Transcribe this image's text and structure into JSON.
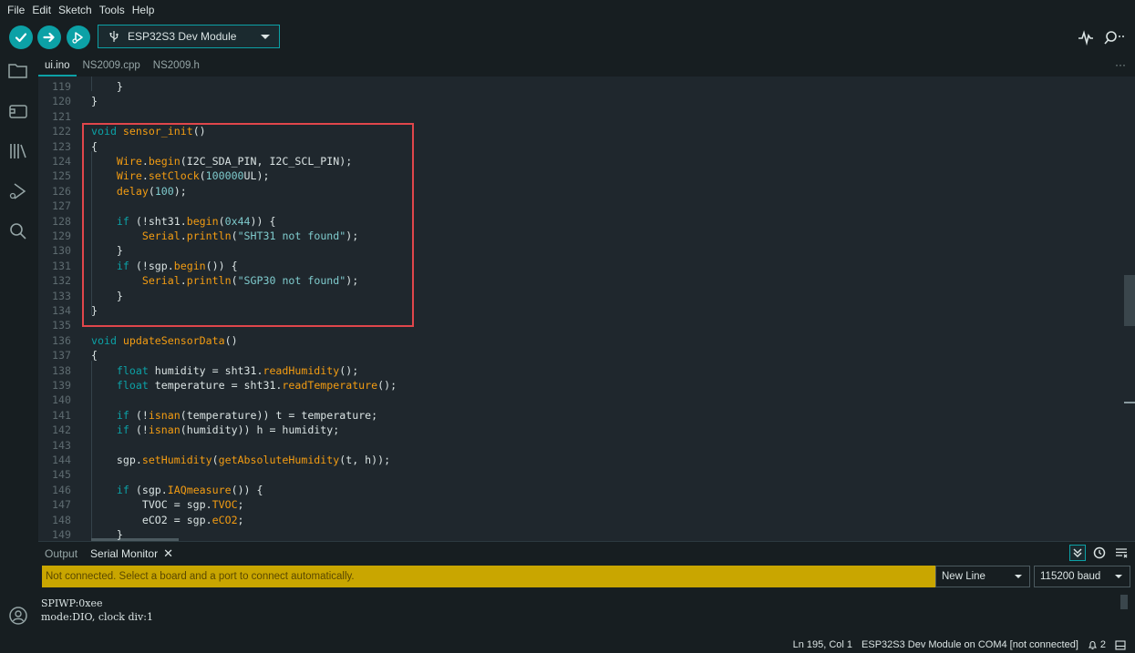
{
  "menu": [
    "File",
    "Edit",
    "Sketch",
    "Tools",
    "Help"
  ],
  "toolbar": {
    "board": "ESP32S3 Dev Module",
    "verify_icon": "check-icon",
    "upload_icon": "arrow-right-icon",
    "debug_icon": "debug-icon"
  },
  "tabs": [
    "ui.ino",
    "NS2009.cpp",
    "NS2009.h"
  ],
  "tab_more": "···",
  "editor": {
    "lines": [
      {
        "n": "119",
        "c": "    }"
      },
      {
        "n": "120",
        "c": "}"
      },
      {
        "n": "121",
        "c": ""
      },
      {
        "n": "122",
        "c": "void sensor_init()"
      },
      {
        "n": "123",
        "c": "{"
      },
      {
        "n": "124",
        "c": "    Wire.begin(I2C_SDA_PIN, I2C_SCL_PIN);"
      },
      {
        "n": "125",
        "c": "    Wire.setClock(100000UL);"
      },
      {
        "n": "126",
        "c": "    delay(100);"
      },
      {
        "n": "127",
        "c": ""
      },
      {
        "n": "128",
        "c": "    if (!sht31.begin(0x44)) {"
      },
      {
        "n": "129",
        "c": "        Serial.println(\"SHT31 not found\");"
      },
      {
        "n": "130",
        "c": "    }"
      },
      {
        "n": "131",
        "c": "    if (!sgp.begin()) {"
      },
      {
        "n": "132",
        "c": "        Serial.println(\"SGP30 not found\");"
      },
      {
        "n": "133",
        "c": "    }"
      },
      {
        "n": "134",
        "c": "}"
      },
      {
        "n": "135",
        "c": ""
      },
      {
        "n": "136",
        "c": "void updateSensorData()"
      },
      {
        "n": "137",
        "c": "{"
      },
      {
        "n": "138",
        "c": "    float humidity = sht31.readHumidity();"
      },
      {
        "n": "139",
        "c": "    float temperature = sht31.readTemperature();"
      },
      {
        "n": "140",
        "c": ""
      },
      {
        "n": "141",
        "c": "    if (!isnan(temperature)) t = temperature;"
      },
      {
        "n": "142",
        "c": "    if (!isnan(humidity)) h = humidity;"
      },
      {
        "n": "143",
        "c": ""
      },
      {
        "n": "144",
        "c": "    sgp.setHumidity(getAbsoluteHumidity(t, h));"
      },
      {
        "n": "145",
        "c": ""
      },
      {
        "n": "146",
        "c": "    if (sgp.IAQmeasure()) {"
      },
      {
        "n": "147",
        "c": "        TVOC = sgp.TVOC;"
      },
      {
        "n": "148",
        "c": "        eCO2 = sgp.eCO2;"
      },
      {
        "n": "149",
        "c": "    }"
      }
    ]
  },
  "panel": {
    "tabs": [
      "Output",
      "Serial Monitor"
    ],
    "close": "✕",
    "notice": "Not connected. Select a board and a port to connect automatically.",
    "line_ending": "New Line",
    "baud": "115200 baud",
    "output": [
      "SPIWP:0xee",
      "mode:DIO, clock div:1"
    ]
  },
  "status": {
    "position": "Ln 195, Col 1",
    "board": "ESP32S3 Dev Module on COM4 [not connected]",
    "notifications": "2"
  },
  "colors": {
    "accent": "#0ca1a6",
    "highlight": "#e0464b",
    "notice": "#c9a600"
  }
}
